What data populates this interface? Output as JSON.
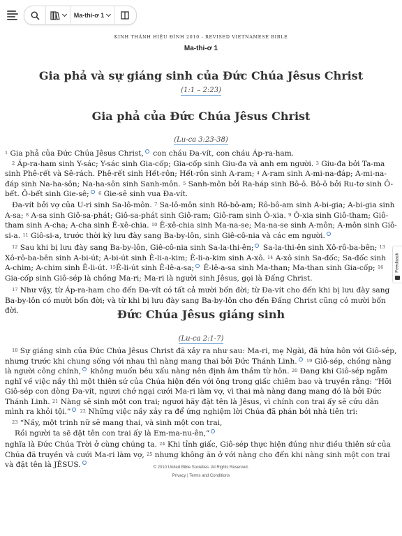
{
  "toolbar": {
    "menu_icon": "hamburger-menu-icon",
    "search_icon": "search-icon",
    "version_icon": "books-icon",
    "book_chapter_label": "Ma-thi-ơ 1",
    "parallel_icon": "parallel-columns-icon"
  },
  "header": {
    "version_name": "KINH THÁNH HIỆU ĐÍNH 2010 - REVISED VIETNAMESE BIBLE",
    "chapter_ref": "Ma-thi-ơ 1"
  },
  "section1": {
    "heading": "Gia phả và sự giáng sinh của Đức Chúa Jêsus Christ",
    "xref": "(1:1 – 2:23)"
  },
  "section2": {
    "heading": "Gia phả của Đức Chúa Jêsus Christ",
    "xref": "(Lu-ca 3:23-38)"
  },
  "section3": {
    "heading": "Đức Chúa Jêsus giáng sinh",
    "xref": "(Lu-ca 2:1-7)"
  },
  "verses": {
    "v1_num": "1",
    "v1": "Gia phả của Đức Chúa Jêsus Christ,",
    "v1b": "con cháu Đa-vít, con cháu Áp-ra-ham.",
    "v2_num": "2",
    "v2": "Áp-ra-ham sinh Y-sác; Y-sác sinh Gia-cốp; Gia-cốp sinh Giu-đa và anh em người.",
    "v3_num": "3",
    "v3": "Giu-đa bởi Ta-ma sinh Phê-rết và Sê-rách. Phê-rết sinh Hết-rôn; Hết-rôn sinh A-ram;",
    "v4_num": "4",
    "v4": "A-ram sinh A-mi-na-đáp; A-mi-na-đáp sinh Na-ha-sôn; Na-ha-sôn sinh Sanh-môn.",
    "v5_num": "5",
    "v5": "Sanh-môn bởi Ra-háp sinh Bô-ô. Bô-ô bởi Ru-tơ sinh Ô-bết. Ô-bết sinh Gie-sê;",
    "v6_num": "6",
    "v6": "Gie-sê sinh vua Đa-vít.",
    "v6b": "Đa-vít bởi vợ của U-ri sinh Sa-lô-môn.",
    "v7_num": "7",
    "v7": "Sa-lô-môn sinh Rô-bô-am; Rô-bô-am sinh A-bi-gia; A-bi-gia sinh A-sa;",
    "v8_num": "8",
    "v8": "A-sa sinh Giô-sa-phát; Giô-sa-phát sinh Giô-ram; Giô-ram sinh Ô-xia.",
    "v9_num": "9",
    "v9": "Ô-xia sinh Giô-tham; Giô-tham sinh A-cha; A-cha sinh Ê-xê-chia.",
    "v10_num": "10",
    "v10": "Ê-xê-chia sinh Ma-na-se; Ma-na-se sinh A-môn; A-môn sinh Giô-si-a.",
    "v11_num": "11",
    "v11": "Giô-si-a, trước thời kỳ lưu đày sang Ba-by-lôn, sinh Giê-cô-nia và các em người.",
    "v12_num": "12",
    "v12": "Sau khi bị lưu đày sang Ba-by-lôn, Giê-cô-nia sinh Sa-la-thi-ên;",
    "v12b": "Sa-la-thi-ên sinh Xô-rô-ba-bên;",
    "v13_num": "13",
    "v13": "Xô-rô-ba-bên sinh A-bi-út; A-bi-út sinh Ê-li-a-kim; Ê-li-a-kim sinh A-xô.",
    "v14_num": "14",
    "v14": "A-xô sinh Sa-đốc; Sa-đốc sinh A-chim; A-chim sinh Ê-li-út.",
    "v15_num": "15",
    "v15": "Ê-li-út sinh Ê-lê-a-sa;",
    "v15b": "Ê-lê-a-sa sinh Ma-than; Ma-than sinh Gia-cốp;",
    "v16_num": "16",
    "v16": "Gia-cốp sinh Giô-sép là chồng Ma-ri; Ma-ri là người sinh Jêsus, gọi là Đấng Christ.",
    "v17_num": "17",
    "v17": "Như vậy, từ Áp-ra-ham cho đến Đa-vít có tất cả mười bốn đời; từ Đa-vít cho đến khi bị lưu đày sang Ba-by-lôn có mười bốn đời; và từ khi bị lưu đày sang Ba-by-lôn cho đến Đấng Christ cũng có mười bốn đời.",
    "v18_num": "18",
    "v18": "Sự giáng sinh của Đức Chúa Jêsus Christ đã xảy ra như sau: Ma-ri, mẹ Ngài, đã hứa hôn với Giô-sép, nhưng trước khi chung sống với nhau thì nàng mang thai bởi Đức Thánh Linh.",
    "v19_num": "19",
    "v19": "Giô-sép, chồng nàng là người công chính,",
    "v19b": "không muốn bêu xấu nàng nên định âm thầm từ hôn.",
    "v20_num": "20",
    "v20": "Đang khi Giô-sép ngẫm nghĩ về việc nầy thì một thiên sứ của Chúa hiện đến với ông trong giấc chiêm bao và truyền rằng: “Hỡi Giô-sép con dòng Đa-vít, ngươi chớ ngại cưới Ma-ri làm vợ, vì thai mà nàng đang mang đó là bởi Đức Thánh Linh.",
    "v21_num": "21",
    "v21": "Nàng sẽ sinh một con trai; ngươi hãy đặt tên là Jêsus, vì chính con trai ấy sẽ cứu dân mình ra khỏi tội.”",
    "v22_num": "22",
    "v22": "Những việc nầy xảy ra để ứng nghiệm lời Chúa đã phán bởi nhà tiên tri:",
    "v23_num": "23",
    "v23": "“Nầy, một trinh nữ sẽ mang thai, và sinh một con trai,",
    "v23b": "Rồi người ta sẽ đặt tên con trai ấy là Em-ma-nu-ên,”",
    "v23c": "nghĩa là Đức Chúa Trời ở cùng chúng ta.",
    "v24_num": "24",
    "v24": "Khi tỉnh giấc, Giô-sép thực hiện đúng như điều thiên sứ của Chúa đã truyền và cưới Ma-ri làm vợ,",
    "v25_num": "25",
    "v25": "nhưng không ăn ở với nàng cho đến khi nàng sinh một con trai và đặt tên là JÊSUS."
  },
  "footer": {
    "copyright": "© 2010 United Bible Societies. All Rights Reserved.",
    "privacy": "Privacy",
    "separator": " | ",
    "terms": "Terms and Conditions"
  },
  "feedback": {
    "label": "Feedback"
  },
  "colors": {
    "note_marker": "#3f7fc8",
    "xref_underline": "#6a9fd0"
  }
}
